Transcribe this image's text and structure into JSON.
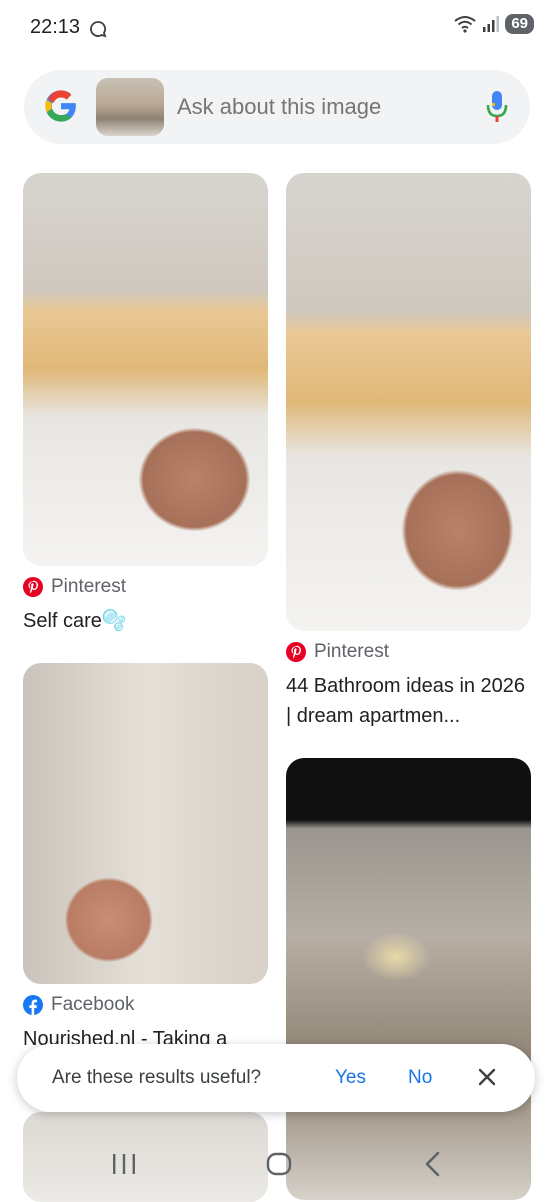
{
  "status_bar": {
    "time": "22:13",
    "battery": "69"
  },
  "search": {
    "placeholder": "Ask about this image"
  },
  "results": [
    {
      "source": "Pinterest",
      "title": "Self care🫧",
      "source_color": "#e60023"
    },
    {
      "source": "Pinterest",
      "title": "44 Bathroom ideas in 2026 | dream apartmen...",
      "source_color": "#e60023"
    },
    {
      "source": "Facebook",
      "title": "Nourished.nl - Taking a",
      "source_color": "#1877f2"
    }
  ],
  "feedback": {
    "question": "Are these results useful?",
    "yes": "Yes",
    "no": "No"
  },
  "colors": {
    "accent": "#1a73e8",
    "surface": "#f1f3f4"
  }
}
